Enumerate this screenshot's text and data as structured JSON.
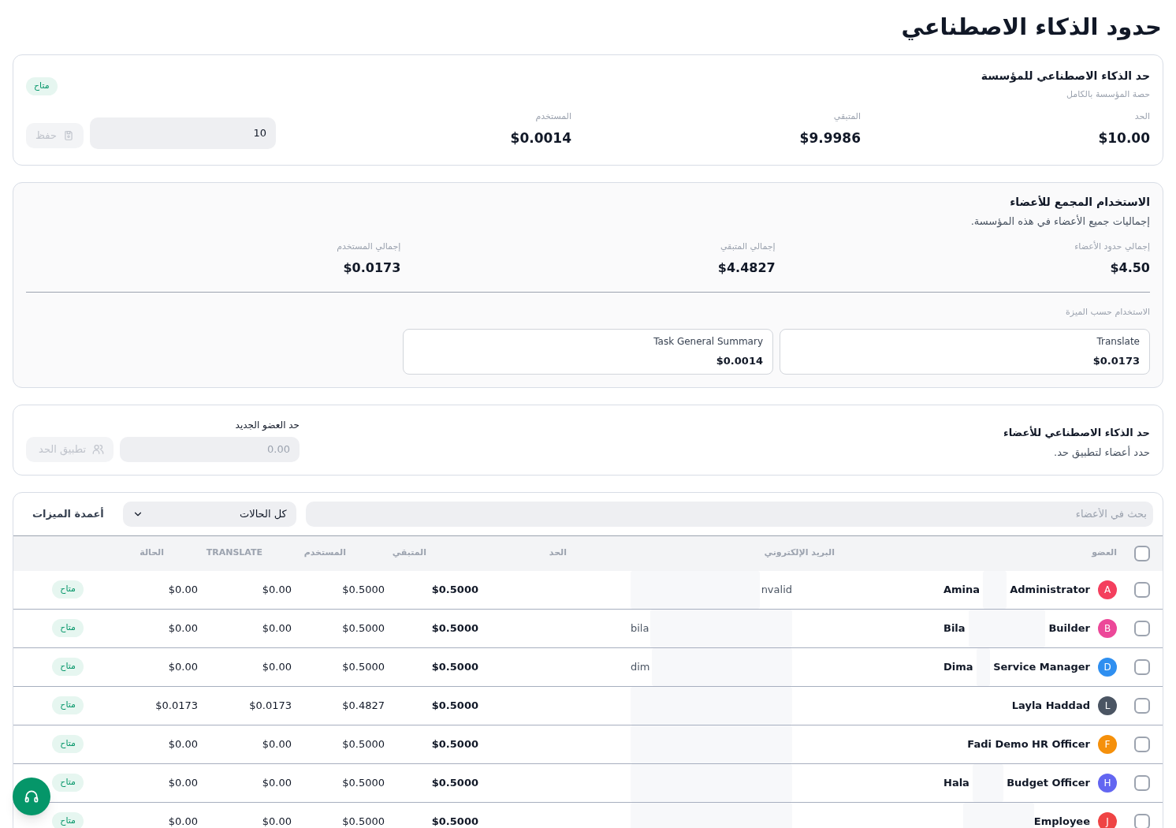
{
  "page_title": "حدود الذكاء الاصطناعي",
  "org_limit": {
    "title": "حد الذكاء الاصطناعي للمؤسسة",
    "subtitle": "حصة المؤسسة بالكامل",
    "status": "متاح",
    "stats": [
      {
        "label": "الحد",
        "value": "$10.00"
      },
      {
        "label": "المتبقي",
        "value": "$9.9986"
      },
      {
        "label": "المستخدم",
        "value": "$0.0014"
      }
    ],
    "input": {
      "value": "10"
    },
    "save_button": {
      "label": "حفظ",
      "disabled": true
    }
  },
  "member_usage": {
    "title": "الاستخدام المجمع للأعضاء",
    "subtitle": "إجماليات جميع الأعضاء في هذه المؤسسة.",
    "totals": [
      {
        "label": "إجمالي حدود الأعضاء",
        "value": "$4.50"
      },
      {
        "label": "إجمالي المتبقي",
        "value": "$4.4827"
      },
      {
        "label": "إجمالي المستخدم",
        "value": "$0.0173"
      }
    ],
    "by_feature_label": "الاستخدام حسب الميزة",
    "features": [
      {
        "name": "Translate",
        "value": "$0.0173"
      },
      {
        "name": "Task General Summary",
        "value": "$0.0014"
      }
    ]
  },
  "member_limit": {
    "title": "حد الذكاء الاصطناعي للأعضاء",
    "subtitle": "حدد أعضاء لتطبيق حد.",
    "field_label": "حد العضو الجديد",
    "placeholder": "0.00",
    "apply_button": {
      "label": "تطبيق الحد",
      "disabled": true
    }
  },
  "members_table": {
    "search": {
      "placeholder": "بحث في الأعضاء"
    },
    "status_filter": {
      "value": "كل الحالات"
    },
    "feature_columns_button": "أعمدة الميزات",
    "header_checkbox": {
      "selected": false
    },
    "columns": [
      "العضو",
      "البريد الإلكتروني",
      "الحد",
      "المتبقي",
      "المستخدم",
      "TRANSLATE",
      "الحالة"
    ],
    "rows": [
      {
        "selected": false,
        "initial": "A",
        "color": "#f43f5e",
        "name_start": "Amina",
        "name_end": "Administrator",
        "email_end": "nvalid",
        "limit": "$0.5000",
        "remaining": "$0.5000",
        "used": "$0.00",
        "translate": "$0.00",
        "status": "متاح"
      },
      {
        "selected": false,
        "initial": "B",
        "color": "#ec4899",
        "name_start": "Bila",
        "name_end": "Builder",
        "email_start": "bila",
        "limit": "$0.5000",
        "remaining": "$0.5000",
        "used": "$0.00",
        "translate": "$0.00",
        "status": "متاح"
      },
      {
        "selected": false,
        "initial": "D",
        "color": "#2f8ff0",
        "name_start": "Dima",
        "name_end": "Service Manager",
        "email_start": "dim",
        "limit": "$0.5000",
        "remaining": "$0.5000",
        "used": "$0.00",
        "translate": "$0.00",
        "status": "متاح"
      },
      {
        "selected": false,
        "initial": "L",
        "color": "#4b5563",
        "name": "Layla Haddad",
        "limit": "$0.5000",
        "remaining": "$0.4827",
        "used": "$0.0173",
        "translate": "$0.0173",
        "status": "متاح"
      },
      {
        "selected": false,
        "initial": "F",
        "color": "#f5900b",
        "name": "Fadi Demo HR Officer",
        "limit": "$0.5000",
        "remaining": "$0.5000",
        "used": "$0.00",
        "translate": "$0.00",
        "status": "متاح"
      },
      {
        "selected": false,
        "initial": "H",
        "color": "#6366f1",
        "name_start": "Hala",
        "name_end": "Budget Officer",
        "limit": "$0.5000",
        "remaining": "$0.5000",
        "used": "$0.00",
        "translate": "$0.00",
        "status": "متاح"
      },
      {
        "selected": false,
        "initial": "J",
        "color": "#ef4444",
        "name_end": "Employee",
        "limit": "$0.5000",
        "remaining": "$0.5000",
        "used": "$0.00",
        "translate": "$0.00",
        "status": "متاح"
      }
    ]
  }
}
